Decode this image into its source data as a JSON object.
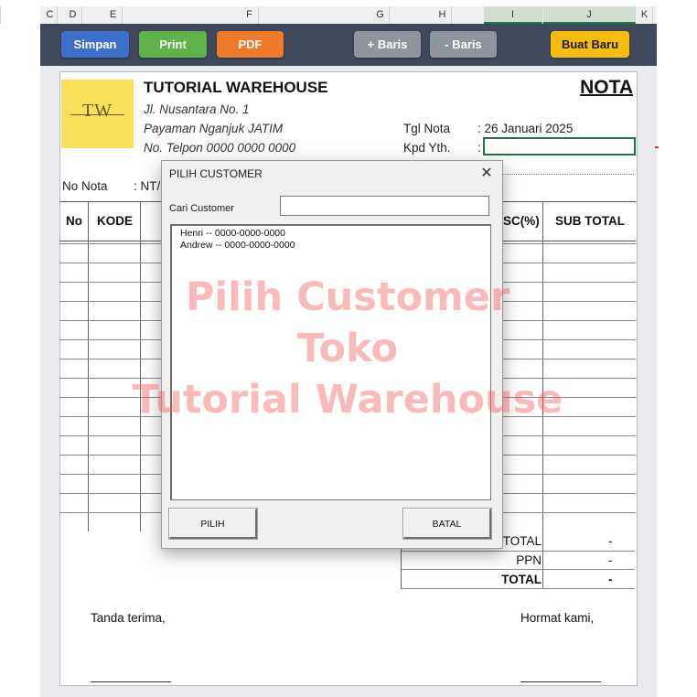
{
  "columns": [
    "C",
    "D",
    "E",
    "F",
    "G",
    "H",
    "I",
    "J",
    "K"
  ],
  "toolbar": {
    "save": "Simpan",
    "print": "Print",
    "pdf": "PDF",
    "add_row": "+ Baris",
    "remove_row": "- Baris",
    "new": "Buat Baru",
    "colors": {
      "save": "#3c6fc9",
      "print": "#5fb34a",
      "pdf": "#ef7a2a",
      "rows": "#8f959c",
      "new": "#f6bd0f"
    }
  },
  "invoice": {
    "logo_text": "TW",
    "company": "TUTORIAL WAREHOUSE",
    "address_1": "Jl. Nusantara No. 1",
    "address_2": "Payaman Nganjuk JATIM",
    "phone": "No. Telpon 0000 0000 0000",
    "title": "NOTA",
    "date_label": "Tgl Nota",
    "date_value": ": 26 Januari 2025",
    "to_label": "Kpd Yth.",
    "to_colon": ":",
    "number_label": "No Nota",
    "number_value": ": NT/",
    "headers": {
      "no": "No",
      "kode": "KODE",
      "disc": "SC(%)",
      "subtotal": "SUB TOTAL"
    },
    "totals": [
      {
        "label": "TOTAL",
        "value": "-"
      },
      {
        "label": "PPN",
        "value": "-"
      },
      {
        "label": "TOTAL",
        "value": "-"
      }
    ],
    "received_by": "Tanda terima,",
    "regards": "Hormat kami,"
  },
  "dialog": {
    "title": "PILIH CUSTOMER",
    "close": "✕",
    "search_label": "Cari Customer",
    "search_value": "",
    "customers": [
      "Henri -- 0000-0000-0000",
      "Andrew -- 0000-0000-0000"
    ],
    "select_button": "PILIH",
    "cancel_button": "BATAL"
  },
  "watermark": [
    "Pilih Customer",
    "Toko",
    "Tutorial Warehouse"
  ]
}
